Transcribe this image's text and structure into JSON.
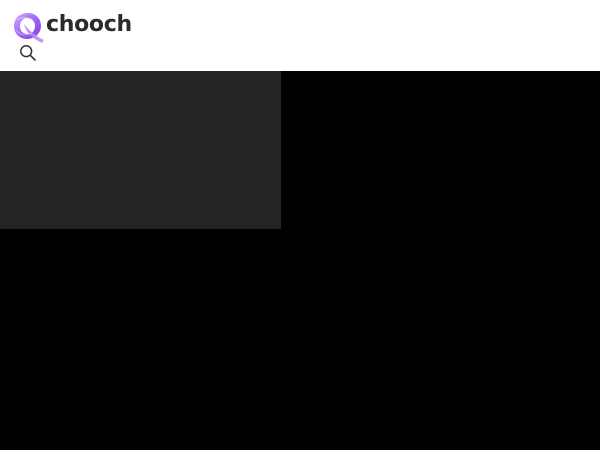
{
  "header": {
    "logo_text": "chooch",
    "logo_icon": "chooch-q-logo-icon",
    "search_icon": "search-icon",
    "background": "#ffffff"
  },
  "colors": {
    "brand_purple": "#8a3ff0",
    "brand_purple_light": "#c79bff",
    "logo_text": "#2b2b2b",
    "page_background": "#000000",
    "panel_background": "#242424"
  }
}
